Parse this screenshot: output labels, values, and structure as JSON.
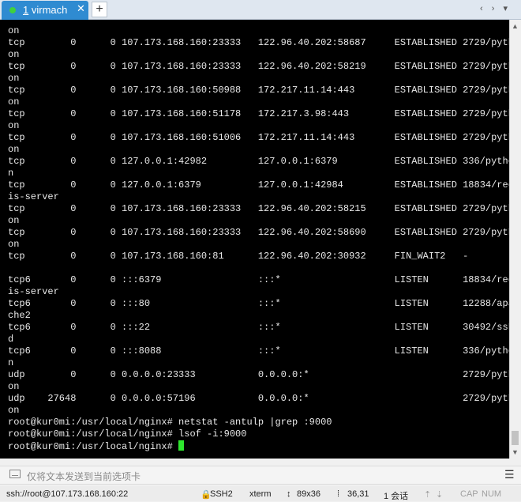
{
  "tab": {
    "number": "1",
    "title": "virmach",
    "close": "✕"
  },
  "toolbar": {
    "new_tab": "+",
    "nav_arrows": "‹ › ▾"
  },
  "terminal": {
    "lines": [
      "on",
      "tcp        0      0 107.173.168.160:23333   122.96.40.202:58687     ESTABLISHED 2729/pyth",
      "on",
      "tcp        0      0 107.173.168.160:23333   122.96.40.202:58219     ESTABLISHED 2729/pyth",
      "on",
      "tcp        0      0 107.173.168.160:50988   172.217.11.14:443       ESTABLISHED 2729/pyth",
      "on",
      "tcp        0      0 107.173.168.160:51178   172.217.3.98:443        ESTABLISHED 2729/pyth",
      "on",
      "tcp        0      0 107.173.168.160:51006   172.217.11.14:443       ESTABLISHED 2729/pyth",
      "on",
      "tcp        0      0 127.0.0.1:42982         127.0.0.1:6379          ESTABLISHED 336/pytho",
      "n",
      "tcp        0      0 127.0.0.1:6379          127.0.0.1:42984         ESTABLISHED 18834/red",
      "is-server",
      "tcp        0      0 107.173.168.160:23333   122.96.40.202:58215     ESTABLISHED 2729/pyth",
      "on",
      "tcp        0      0 107.173.168.160:23333   122.96.40.202:58690     ESTABLISHED 2729/pyth",
      "on",
      "tcp        0      0 107.173.168.160:81      122.96.40.202:30932     FIN_WAIT2   -",
      "",
      "tcp6       0      0 :::6379                 :::*                    LISTEN      18834/red",
      "is-server",
      "tcp6       0      0 :::80                   :::*                    LISTEN      12288/apa",
      "che2",
      "tcp6       0      0 :::22                   :::*                    LISTEN      30492/ssh",
      "d",
      "tcp6       0      0 :::8088                 :::*                    LISTEN      336/pytho",
      "n",
      "udp        0      0 0.0.0.0:23333           0.0.0.0:*                           2729/pyth",
      "on",
      "udp    27648      0 0.0.0.0:57196           0.0.0.0:*                           2729/pyth",
      "on",
      "root@kur0mi:/usr/local/nginx# netstat -antulp |grep :9000",
      "root@kur0mi:/usr/local/nginx# lsof -i:9000"
    ],
    "prompt": "root@kur0mi:/usr/local/nginx# "
  },
  "send_bar": {
    "placeholder": "仅将文本发送到当前选项卡",
    "menu_icon": "☰"
  },
  "status_bar": {
    "host": "ssh://root@107.173.168.160:22",
    "protocol": "SSH2",
    "terminal_type": "xterm",
    "size": "89x36",
    "cursor_pos": "36,31",
    "sessions": "1 会话",
    "caps": "CAP",
    "num": "NUM"
  },
  "colors": {
    "tab_active": "#2f8bd1",
    "status_dot": "#3fd13f",
    "terminal_bg": "#000000",
    "terminal_fg": "#e8e8e8",
    "cursor": "#2ee62e"
  }
}
